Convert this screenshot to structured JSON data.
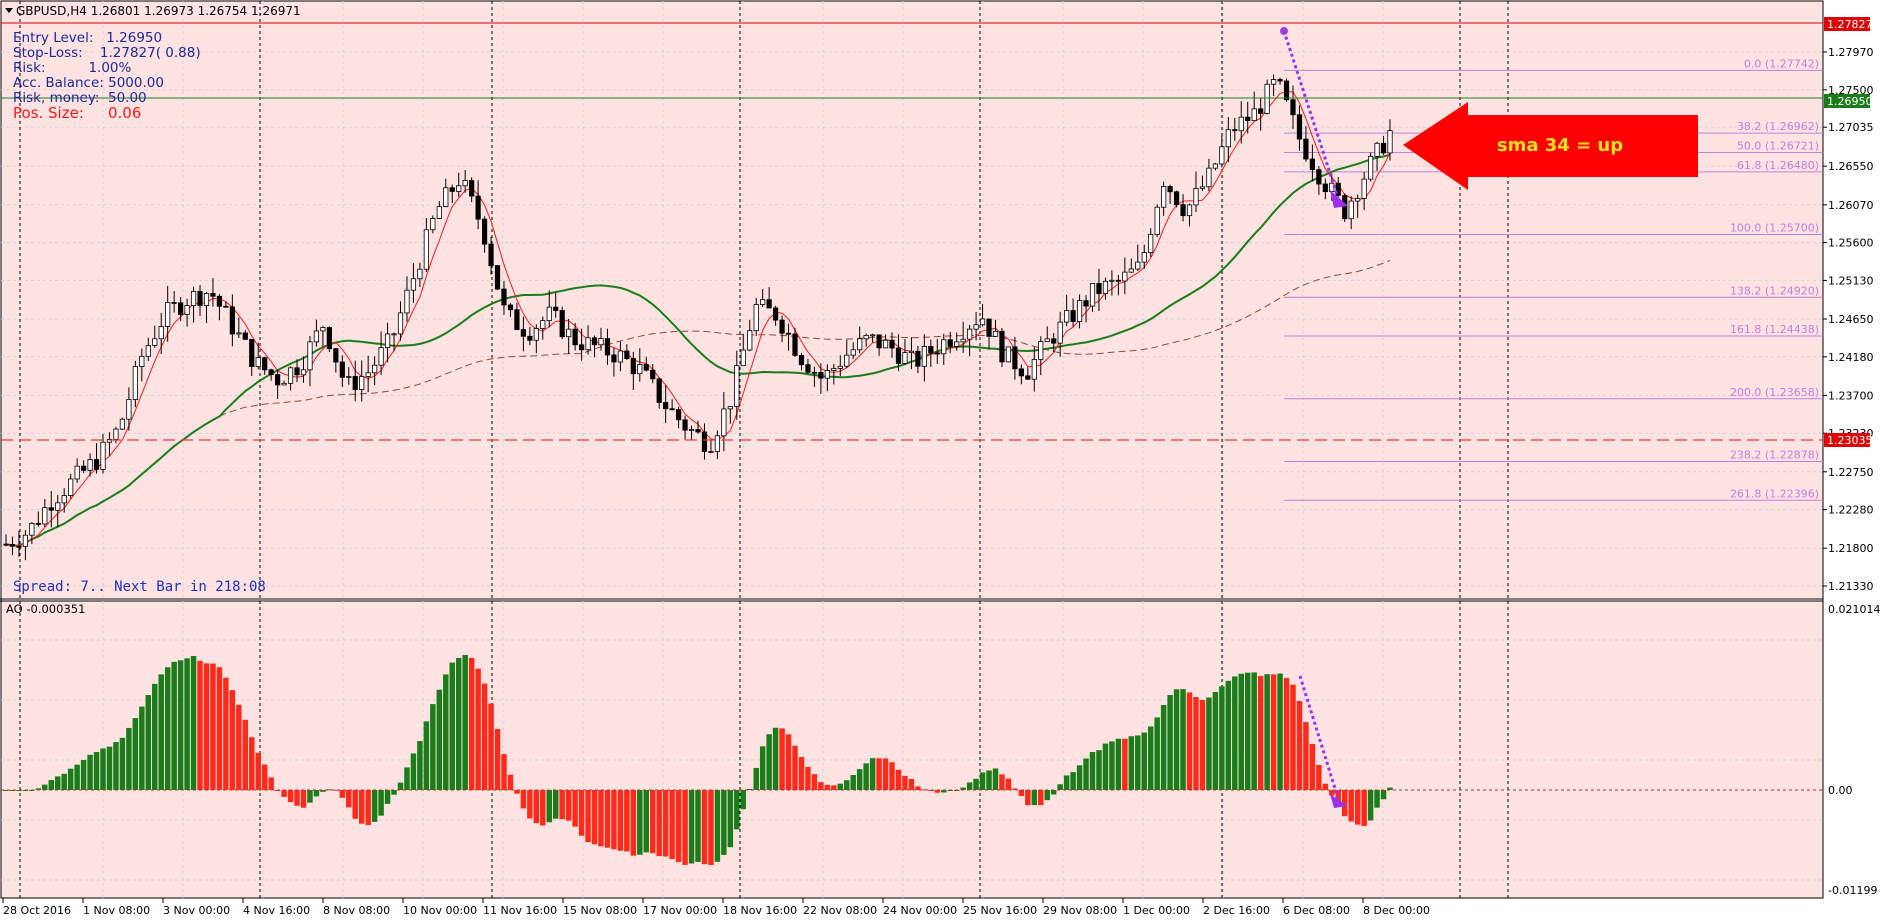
{
  "window": {
    "symbol_line": "GBPUSD,H4  1.26801 1.26973 1.26754 1.26971"
  },
  "position_panel": {
    "lines": [
      "Entry Level:   1.26950",
      "Stop-Loss:    1.27827( 0.88)",
      "Risk:          1.00%",
      "Acc. Balance: 5000.00",
      "Risk, money:  50.00"
    ],
    "pos_size_label": "Pos. Size:",
    "pos_size_value": "0.06"
  },
  "status_text": "Spread: 7.. Next Bar in 218:08",
  "annotation": {
    "arrow_text": "sma 34 = up"
  },
  "price_axis": {
    "ticks": [
      "1.27970",
      "1.27500",
      "1.27035",
      "1.26550",
      "1.26070",
      "1.25600",
      "1.25130",
      "1.24650",
      "1.24180",
      "1.23700",
      "1.23230",
      "1.22750",
      "1.22280",
      "1.21800",
      "1.21330"
    ],
    "stop_loss_tag": "1.27827",
    "entry_tag": "1.26950",
    "hline_tag": "1.23035"
  },
  "fibonacci": {
    "levels": [
      {
        "label": "0.0  (1.27742)",
        "price": 1.27742
      },
      {
        "label": "38.2  (1.26962)",
        "price": 1.26962
      },
      {
        "label": "50.0  (1.26721)",
        "price": 1.26721
      },
      {
        "label": "61.8  (1.26480)",
        "price": 1.2648
      },
      {
        "label": "100.0  (1.25700)",
        "price": 1.257
      },
      {
        "label": "138.2  (1.24920)",
        "price": 1.2492
      },
      {
        "label": "161.8  (1.24438)",
        "price": 1.24438
      },
      {
        "label": "200.0  (1.23658)",
        "price": 1.23658
      },
      {
        "label": "238.2  (1.22878)",
        "price": 1.22878
      },
      {
        "label": "261.8  (1.22396)",
        "price": 1.22396
      }
    ]
  },
  "indicator": {
    "label": "AO -0.000351",
    "axis_ticks": [
      "0.021014",
      "0.00",
      "-0.01199"
    ]
  },
  "time_axis": {
    "labels": [
      "28 Oct 2016",
      "1 Nov 08:00",
      "3 Nov 00:00",
      "4 Nov 16:00",
      "8 Nov 08:00",
      "10 Nov 00:00",
      "11 Nov 16:00",
      "15 Nov 08:00",
      "17 Nov 00:00",
      "18 Nov 16:00",
      "22 Nov 08:00",
      "24 Nov 00:00",
      "25 Nov 16:00",
      "29 Nov 08:00",
      "1 Dec 00:00",
      "2 Dec 16:00",
      "6 Dec 08:00",
      "8 Dec 00:00"
    ]
  },
  "colors": {
    "background": "#ffe2e2",
    "bull_bar": "#1a7d1a",
    "bear_bar": "#ff2a1a",
    "sma_green": "#1a7d1a",
    "ema_red": "#ff1a1a",
    "fib": "#c080e0",
    "arrow": "#ff0000",
    "arrow_text": "#ffe020",
    "panel_text": "#1a2a9a"
  },
  "chart_data": {
    "type": "candlestick",
    "series": [
      {
        "name": "GBPUSD,H4",
        "close_points": [
          1.2185,
          1.2201,
          1.224,
          1.2265,
          1.229,
          1.233,
          1.242,
          1.247,
          1.249,
          1.25,
          1.2455,
          1.241,
          1.239,
          1.241,
          1.246,
          1.238,
          1.24,
          1.244,
          1.252,
          1.26,
          1.264,
          1.258,
          1.247,
          1.245,
          1.247,
          1.244,
          1.243,
          1.242,
          1.24,
          1.236,
          1.233,
          1.231,
          1.237,
          1.248,
          1.247,
          1.242,
          1.239,
          1.242,
          1.244,
          1.243,
          1.241,
          1.243,
          1.245,
          1.247,
          1.242,
          1.24,
          1.244,
          1.247,
          1.25,
          1.251,
          1.253,
          1.264,
          1.26,
          1.264,
          1.27,
          1.272,
          1.276,
          1.269,
          1.264,
          1.26,
          1.265,
          1.2697
        ]
      }
    ],
    "moving_averages": [
      "red fast MA",
      "green MA",
      "dashed brown MA"
    ],
    "ylim": [
      1.2133,
      1.2797
    ],
    "indicator_ylim": [
      -0.01199,
      0.021014
    ]
  }
}
